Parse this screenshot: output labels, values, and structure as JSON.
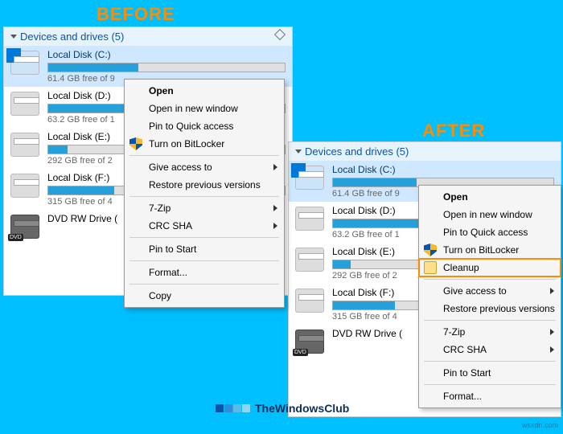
{
  "labels": {
    "before": "BEFORE",
    "after": "AFTER"
  },
  "watermark": "wsxdn.com",
  "branding": "TheWindowsClub",
  "header": "Devices and drives (5)",
  "drives": [
    {
      "name": "Local Disk (C:)",
      "free_before": "61.4 GB free of 9",
      "free_after": "61.4 GB free of 9",
      "fill": 38,
      "selected": true,
      "type": "os"
    },
    {
      "name": "Local Disk (D:)",
      "free_before": "63.2 GB free of 1",
      "free_after": "63.2 GB free of 1",
      "fill": 40,
      "type": "hdd"
    },
    {
      "name": "Local Disk (E:)",
      "free_before": "292 GB free of 2",
      "free_after": "292 GB free of 2",
      "fill": 8,
      "type": "hdd"
    },
    {
      "name": "Local Disk (F:)",
      "free_before": "315 GB free of 4",
      "free_after": "315 GB free of 4",
      "fill": 28,
      "type": "hdd"
    },
    {
      "name": "DVD RW Drive (",
      "name_after": "DVD RW Drive (",
      "type": "dvd"
    }
  ],
  "menu_before": [
    {
      "label": "Open",
      "bold": true
    },
    {
      "label": "Open in new window"
    },
    {
      "label": "Pin to Quick access"
    },
    {
      "label": "Turn on BitLocker",
      "icon": "shield"
    },
    {
      "sep": true
    },
    {
      "label": "Give access to",
      "submenu": true
    },
    {
      "label": "Restore previous versions"
    },
    {
      "sep": true
    },
    {
      "label": "7-Zip",
      "submenu": true
    },
    {
      "label": "CRC SHA",
      "submenu": true
    },
    {
      "sep": true
    },
    {
      "label": "Pin to Start"
    },
    {
      "sep": true
    },
    {
      "label": "Format..."
    },
    {
      "sep": true
    },
    {
      "label": "Copy"
    }
  ],
  "menu_after": [
    {
      "label": "Open",
      "bold": true
    },
    {
      "label": "Open in new window"
    },
    {
      "label": "Pin to Quick access"
    },
    {
      "label": "Turn on BitLocker",
      "icon": "shield"
    },
    {
      "label": "Cleanup",
      "icon": "disk",
      "highlight": true
    },
    {
      "sep": true
    },
    {
      "label": "Give access to",
      "submenu": true
    },
    {
      "label": "Restore previous versions"
    },
    {
      "sep": true
    },
    {
      "label": "7-Zip",
      "submenu": true
    },
    {
      "label": "CRC SHA",
      "submenu": true
    },
    {
      "sep": true
    },
    {
      "label": "Pin to Start"
    },
    {
      "sep": true
    },
    {
      "label": "Format..."
    }
  ]
}
